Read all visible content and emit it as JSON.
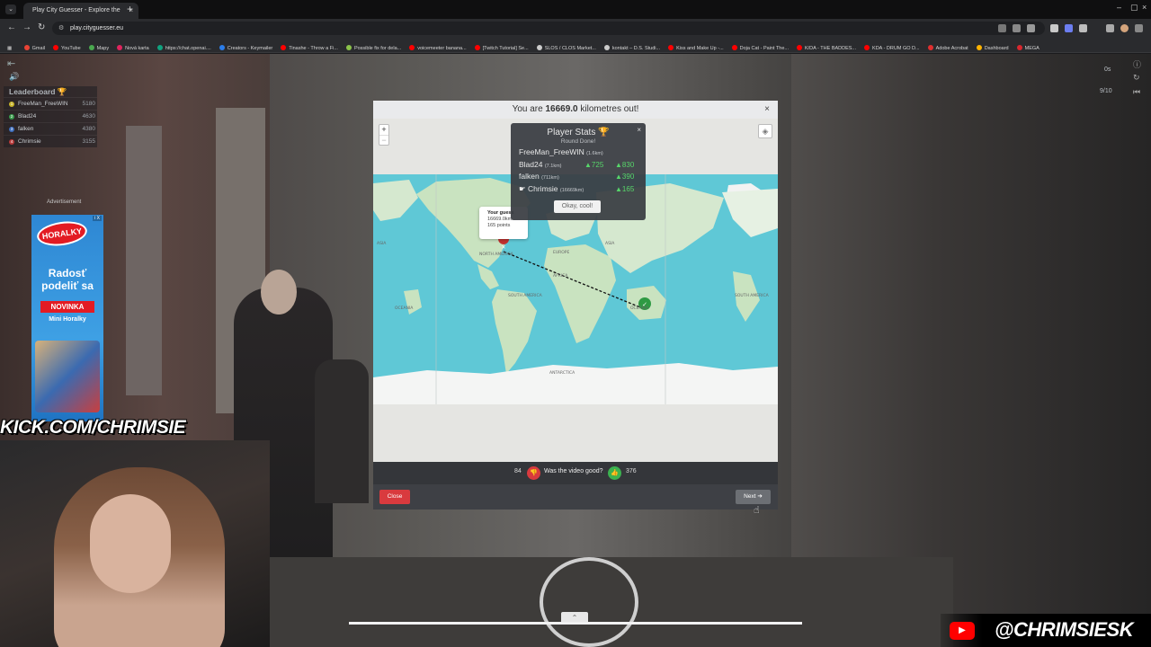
{
  "browser": {
    "tab_title": "Play City Guesser - Explore the",
    "url": "play.cityguesser.eu",
    "bookmarks": [
      {
        "label": "Gmail",
        "color": "#ea4335"
      },
      {
        "label": "YouTube",
        "color": "#ff0000"
      },
      {
        "label": "Mapy",
        "color": "#4aa84f"
      },
      {
        "label": "Nová karta",
        "color": "#e0245e"
      },
      {
        "label": "https://chat.openai....",
        "color": "#10a37f"
      },
      {
        "label": "Creators - Keymailer",
        "color": "#2b7de9"
      },
      {
        "label": "Tinashe - Throw a Fi...",
        "color": "#ff0000"
      },
      {
        "label": "Possible fix for dela...",
        "color": "#8bc34a"
      },
      {
        "label": "voicemeeter banana...",
        "color": "#ff0000"
      },
      {
        "label": "[Twitch Tutorial] Se...",
        "color": "#ff0000"
      },
      {
        "label": "SLOS / CLOS Market...",
        "color": "#cccccc"
      },
      {
        "label": "kontakt – D.S. Studi...",
        "color": "#cccccc"
      },
      {
        "label": "Kiss and Make Up -...",
        "color": "#ff0000"
      },
      {
        "label": "Doja Cat - Paint The...",
        "color": "#ff0000"
      },
      {
        "label": "K/DA - THE BADDES...",
        "color": "#ff0000"
      },
      {
        "label": "KDA - DRUM GO D...",
        "color": "#ff0000"
      },
      {
        "label": "Adobe Acrobat",
        "color": "#e02f2f"
      },
      {
        "label": "Dashboard",
        "color": "#ffb300"
      },
      {
        "label": "MEGA",
        "color": "#d9272e"
      }
    ]
  },
  "hud": {
    "leaderboard_title": "Leaderboard",
    "leaderboard": [
      {
        "rank": "1",
        "name": "FreeMan_FreeWIN",
        "score": "5180",
        "color": "#c9b52a"
      },
      {
        "rank": "2",
        "name": "Blad24",
        "score": "4630",
        "color": "#3a9c4d"
      },
      {
        "rank": "3",
        "name": "falken",
        "score": "4380",
        "color": "#3f6fbf"
      },
      {
        "rank": "4",
        "name": "Chrimsie",
        "score": "3155",
        "color": "#b83a3a"
      }
    ],
    "timer": "0s",
    "round": "9/10"
  },
  "ad": {
    "label": "Advertisement",
    "brand": "HORALKY",
    "line1": "Radosť",
    "line2": "podeliť sa",
    "badge": "NOVINKA",
    "product": "Mini Horalky",
    "corner": "i X"
  },
  "stream": {
    "kick": "KICK.COM/CHRIMSIE",
    "youtube": "@CHRIMSIESK"
  },
  "result": {
    "prefix": "You are",
    "distance": "16669.0",
    "suffix": "kilometres out!"
  },
  "map": {
    "zoom_in": "+",
    "zoom_out": "−",
    "labels": [
      "NORTH AMERICA",
      "EUROPE",
      "ASIA",
      "ASIA",
      "AFRICA",
      "SOUTH AMERICA",
      "OCEANIA",
      "OCEANIA",
      "SOUTH AMERICA",
      "ANTARCTICA"
    ],
    "guess_title": "Your guess",
    "guess_distance": "16669.0km",
    "guess_points": "165 points"
  },
  "stats": {
    "title": "Player Stats",
    "subtitle": "Round Done!",
    "rows": [
      {
        "name": "FreeMan_FreeWIN",
        "dist": "(1.6km)",
        "delta": "",
        "total": ""
      },
      {
        "name": "Blad24",
        "dist": "(7.1km)",
        "delta": "725",
        "total": "830"
      },
      {
        "name": "falken",
        "dist": "(711km)",
        "delta": "",
        "total": "390"
      },
      {
        "name": "Chrimsie",
        "dist": "(16669km)",
        "delta": "",
        "total": "165"
      }
    ],
    "okay": "Okay, cool!"
  },
  "vote": {
    "down": "84",
    "question": "Was the video good?",
    "up": "376"
  },
  "footer": {
    "close": "Close",
    "next": "Next"
  }
}
